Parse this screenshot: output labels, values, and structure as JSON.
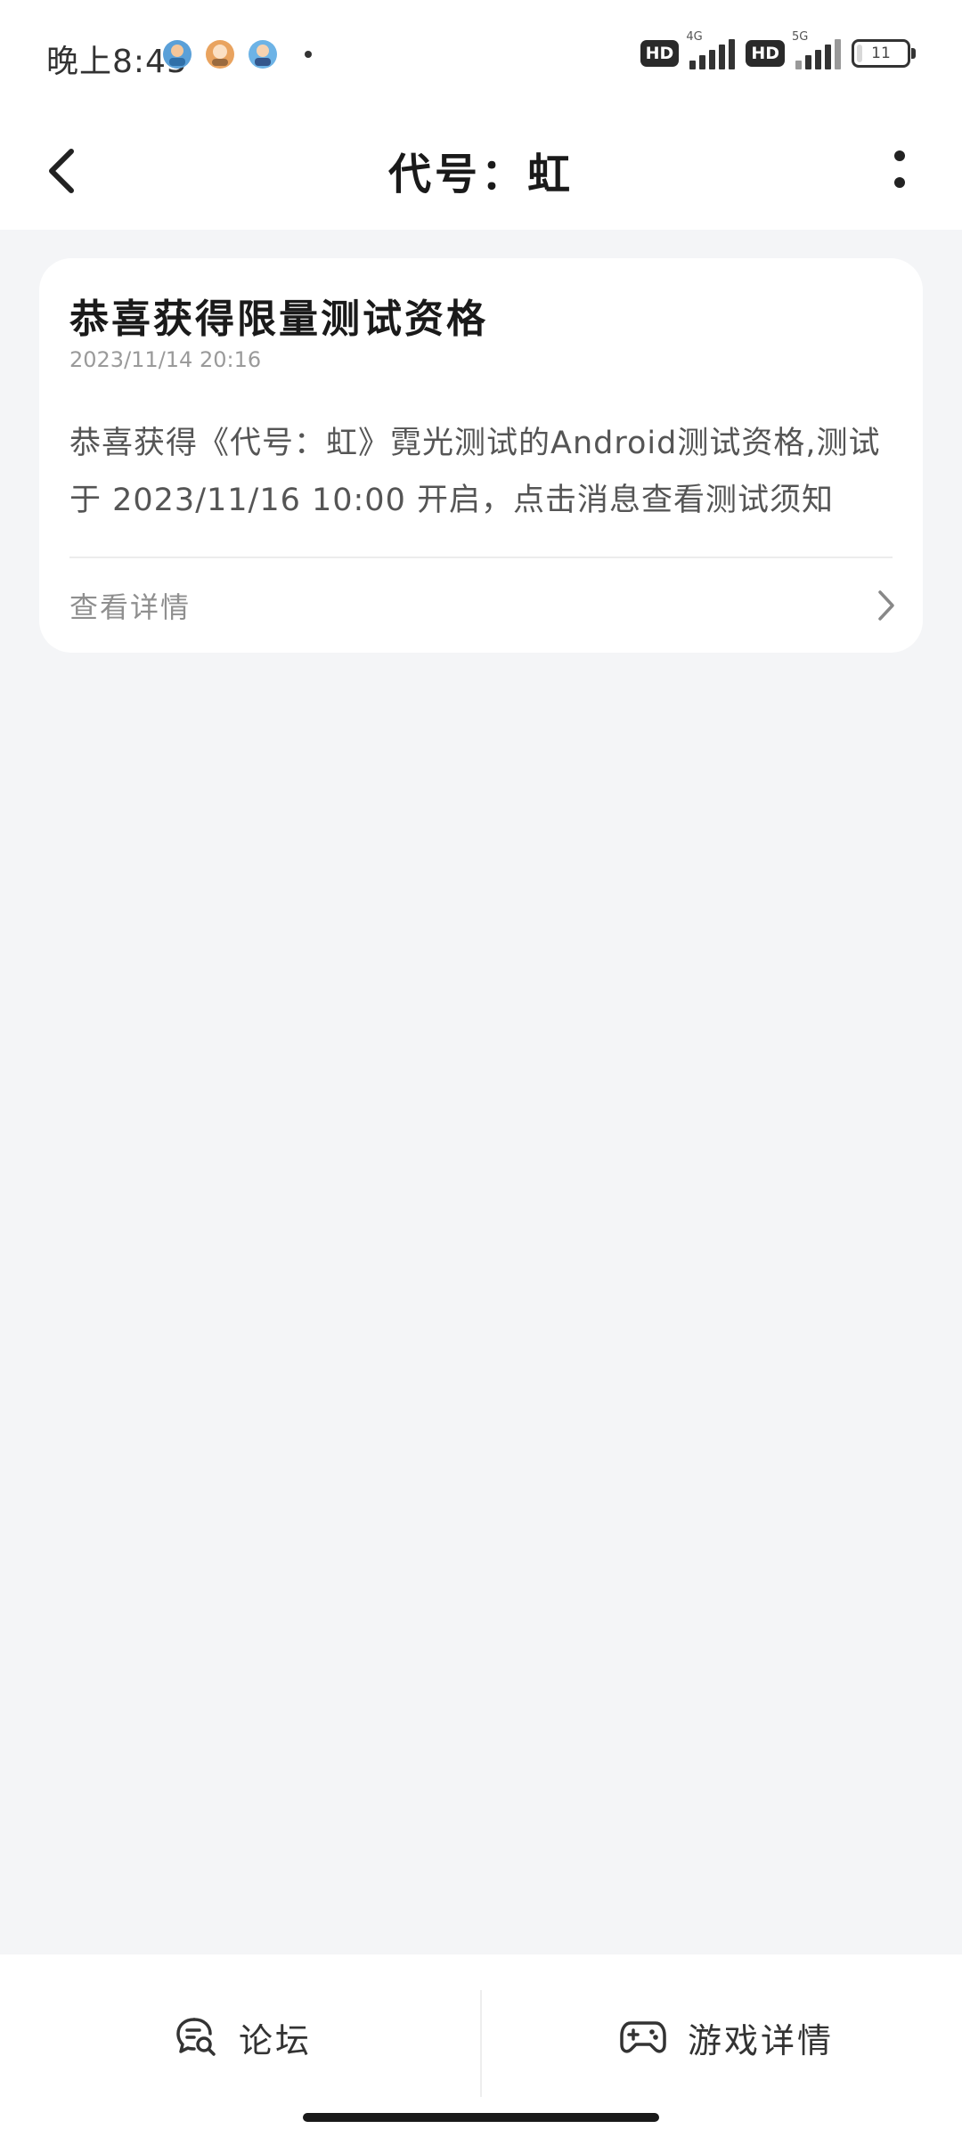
{
  "status_bar": {
    "time": "晚上8:45",
    "network_1": "4G",
    "network_2": "5G",
    "hd_label": "HD",
    "battery": "11",
    "battery_level": 0.11
  },
  "header": {
    "title": "代号：虹"
  },
  "message": {
    "title": "恭喜获得限量测试资格",
    "date": "2023/11/14  20:16",
    "body": "恭喜获得《代号：虹》霓光测试的Android测试资格,测试于 2023/11/16 10:00 开启，点击消息查看测试须知",
    "detail_label": "查看详情"
  },
  "bottom_bar": {
    "forum_label": "论坛",
    "game_detail_label": "游戏详情"
  },
  "colors": {
    "page_background": "#f4f5f7",
    "card_background": "#ffffff",
    "text_primary": "#1a1a1a",
    "text_secondary": "#8f8f8f"
  },
  "icons": {
    "back": "chevron-left-icon",
    "more": "vertical-dots-icon",
    "detail": "chevron-right-icon",
    "forum": "chat-search-icon",
    "game": "gamepad-icon"
  }
}
